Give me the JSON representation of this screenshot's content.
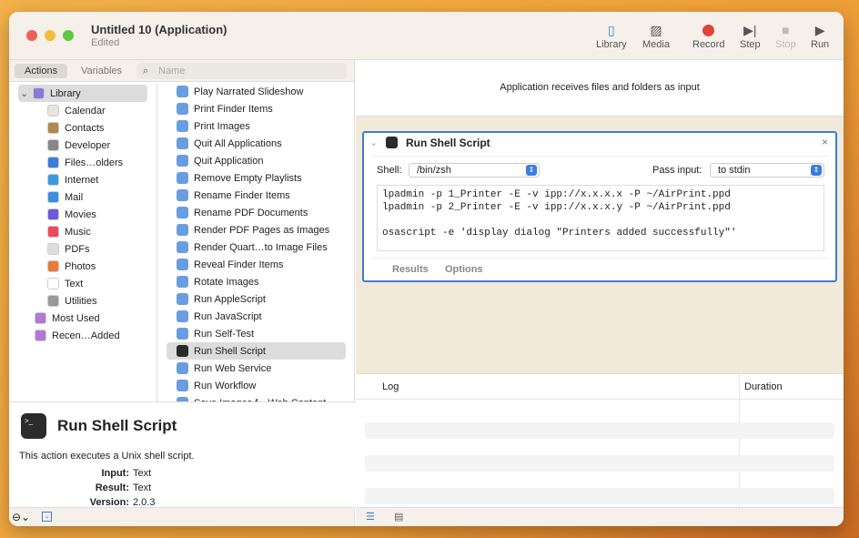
{
  "window": {
    "title": "Untitled 10 (Application)",
    "subtitle": "Edited"
  },
  "toolbar": [
    {
      "label": "Library",
      "icon": "sidebar-icon"
    },
    {
      "label": "Media",
      "icon": "photos-icon"
    },
    {
      "label": "Record",
      "icon": "record-icon"
    },
    {
      "label": "Step",
      "icon": "step-icon"
    },
    {
      "label": "Stop",
      "icon": "stop-icon"
    },
    {
      "label": "Run",
      "icon": "play-icon"
    }
  ],
  "library_tabs": {
    "actions": "Actions",
    "variables": "Variables"
  },
  "search": {
    "placeholder": "Name"
  },
  "categories": [
    "Library",
    "Calendar",
    "Contacts",
    "Developer",
    "Files…olders",
    "Internet",
    "Mail",
    "Movies",
    "Music",
    "PDFs",
    "Photos",
    "Text",
    "Utilities",
    "Most Used",
    "Recen…Added"
  ],
  "actions": [
    "Play Narrated Slideshow",
    "Print Finder Items",
    "Print Images",
    "Quit All Applications",
    "Quit Application",
    "Remove Empty Playlists",
    "Rename Finder Items",
    "Rename PDF Documents",
    "Render PDF Pages as Images",
    "Render Quart…to Image Files",
    "Reveal Finder Items",
    "Rotate Images",
    "Run AppleScript",
    "Run JavaScript",
    "Run Self-Test",
    "Run Shell Script",
    "Run Web Service",
    "Run Workflow",
    "Save Images f…Web Content"
  ],
  "selected_action": "Run Shell Script",
  "description": {
    "title": "Run Shell Script",
    "text": "This action executes a Unix shell script.",
    "input_label": "Input:",
    "input": "Text",
    "result_label": "Result:",
    "result": "Text",
    "version_label": "Version:",
    "version": "2.0.3"
  },
  "workflow": {
    "receives": "Application receives files and folders as input",
    "card": {
      "title": "Run Shell Script",
      "shell_label": "Shell:",
      "shell": "/bin/zsh",
      "pass_label": "Pass input:",
      "pass": "to stdin",
      "script": "lpadmin -p 1_Printer -E -v ipp://x.x.x.x -P ~/AirPrint.ppd\nlpadmin -p 2_Printer -E -v ipp://x.x.x.y -P ~/AirPrint.ppd\n\nosascript -e 'display dialog \"Printers added successfully\"'",
      "results": "Results",
      "options": "Options"
    }
  },
  "log": {
    "col_log": "Log",
    "col_duration": "Duration"
  },
  "colors": {
    "accent": "#3b7ddd",
    "record": "#e0443a",
    "workflow_bg": "#f2ead9"
  }
}
